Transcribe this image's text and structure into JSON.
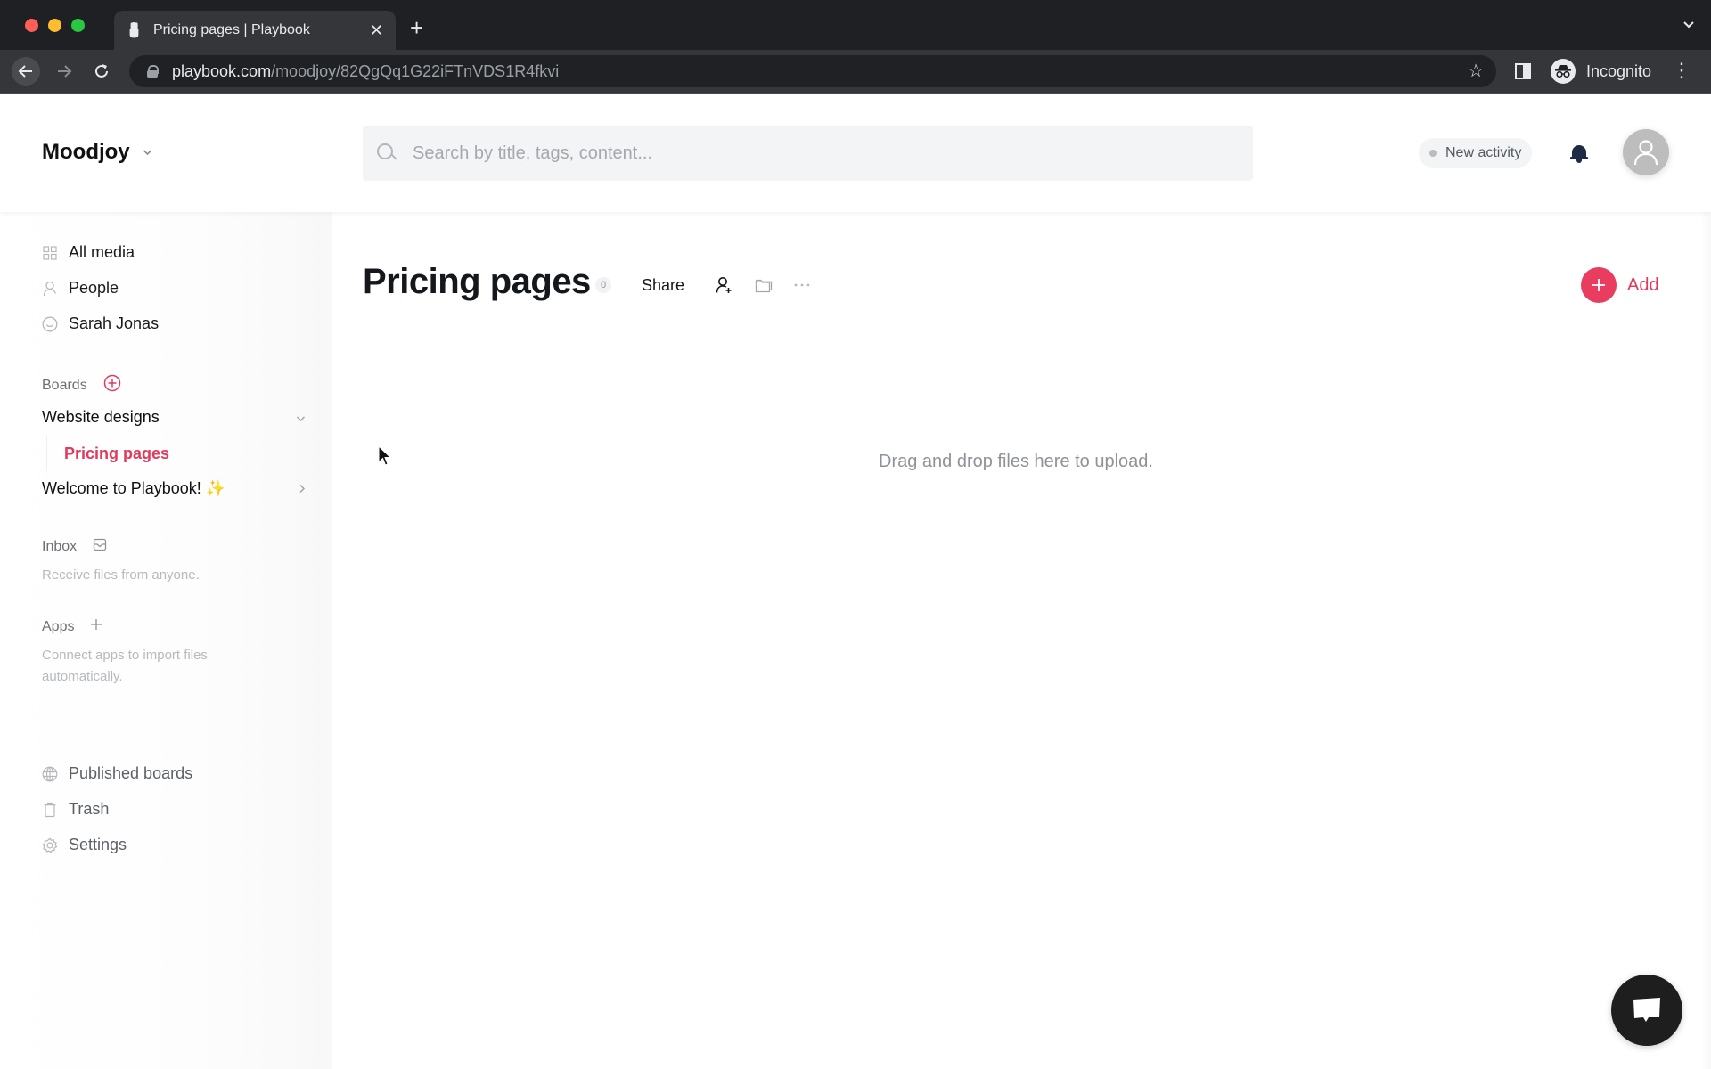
{
  "browser": {
    "tab_title": "Pricing pages | Playbook",
    "url_host": "playbook.com",
    "url_path": "/moodjoy/82QgQq1G22iFTnVDS1R4fkvi",
    "profile_label": "Incognito",
    "icons": {
      "favicon": "playbook-hand-icon",
      "close": "close-icon",
      "new_tab": "plus-icon",
      "tab_search": "chevron-down-icon",
      "back": "arrow-left-icon",
      "forward": "arrow-right-icon",
      "reload": "reload-icon",
      "lock": "lock-icon",
      "bookmark": "star-icon",
      "side_panel": "side-panel-icon",
      "incognito": "incognito-icon",
      "menu": "kebab-menu-icon"
    }
  },
  "header": {
    "workspace_name": "Moodjoy",
    "search_placeholder": "Search by title, tags, content...",
    "new_activity_label": "New activity",
    "icons": {
      "workspace_chevron": "chevron-down-icon",
      "search": "search-icon",
      "notifications": "bell-icon",
      "avatar": "user-avatar-icon"
    }
  },
  "sidebar": {
    "nav": [
      {
        "label": "All media",
        "icon": "grid-icon"
      },
      {
        "label": "People",
        "icon": "person-icon"
      },
      {
        "label": "Sarah Jonas",
        "icon": "smiley-icon"
      }
    ],
    "boards_label": "Boards",
    "boards": [
      {
        "label": "Website designs",
        "expanded": true,
        "children": [
          {
            "label": "Pricing pages",
            "active": true
          }
        ]
      },
      {
        "label": "Welcome to Playbook! ✨",
        "expanded": false
      }
    ],
    "inbox_label": "Inbox",
    "inbox_desc": "Receive files from anyone.",
    "apps_label": "Apps",
    "apps_desc": "Connect apps to import files automatically.",
    "footer_nav": [
      {
        "label": "Published boards",
        "icon": "globe-icon"
      },
      {
        "label": "Trash",
        "icon": "trash-icon"
      },
      {
        "label": "Settings",
        "icon": "gear-icon"
      }
    ]
  },
  "main": {
    "title": "Pricing pages",
    "item_count": "0",
    "share_label": "Share",
    "add_label": "Add",
    "drop_hint": "Drag and drop files here to upload.",
    "toolbar_icons": [
      "add-person-icon",
      "folder-icon",
      "more-horizontal-icon"
    ]
  },
  "colors": {
    "accent": "#e23a5c",
    "add_button": "#e83d5f",
    "title_text": "#14171c",
    "muted_text": "#8f9399",
    "chrome_bg": "#202124"
  }
}
